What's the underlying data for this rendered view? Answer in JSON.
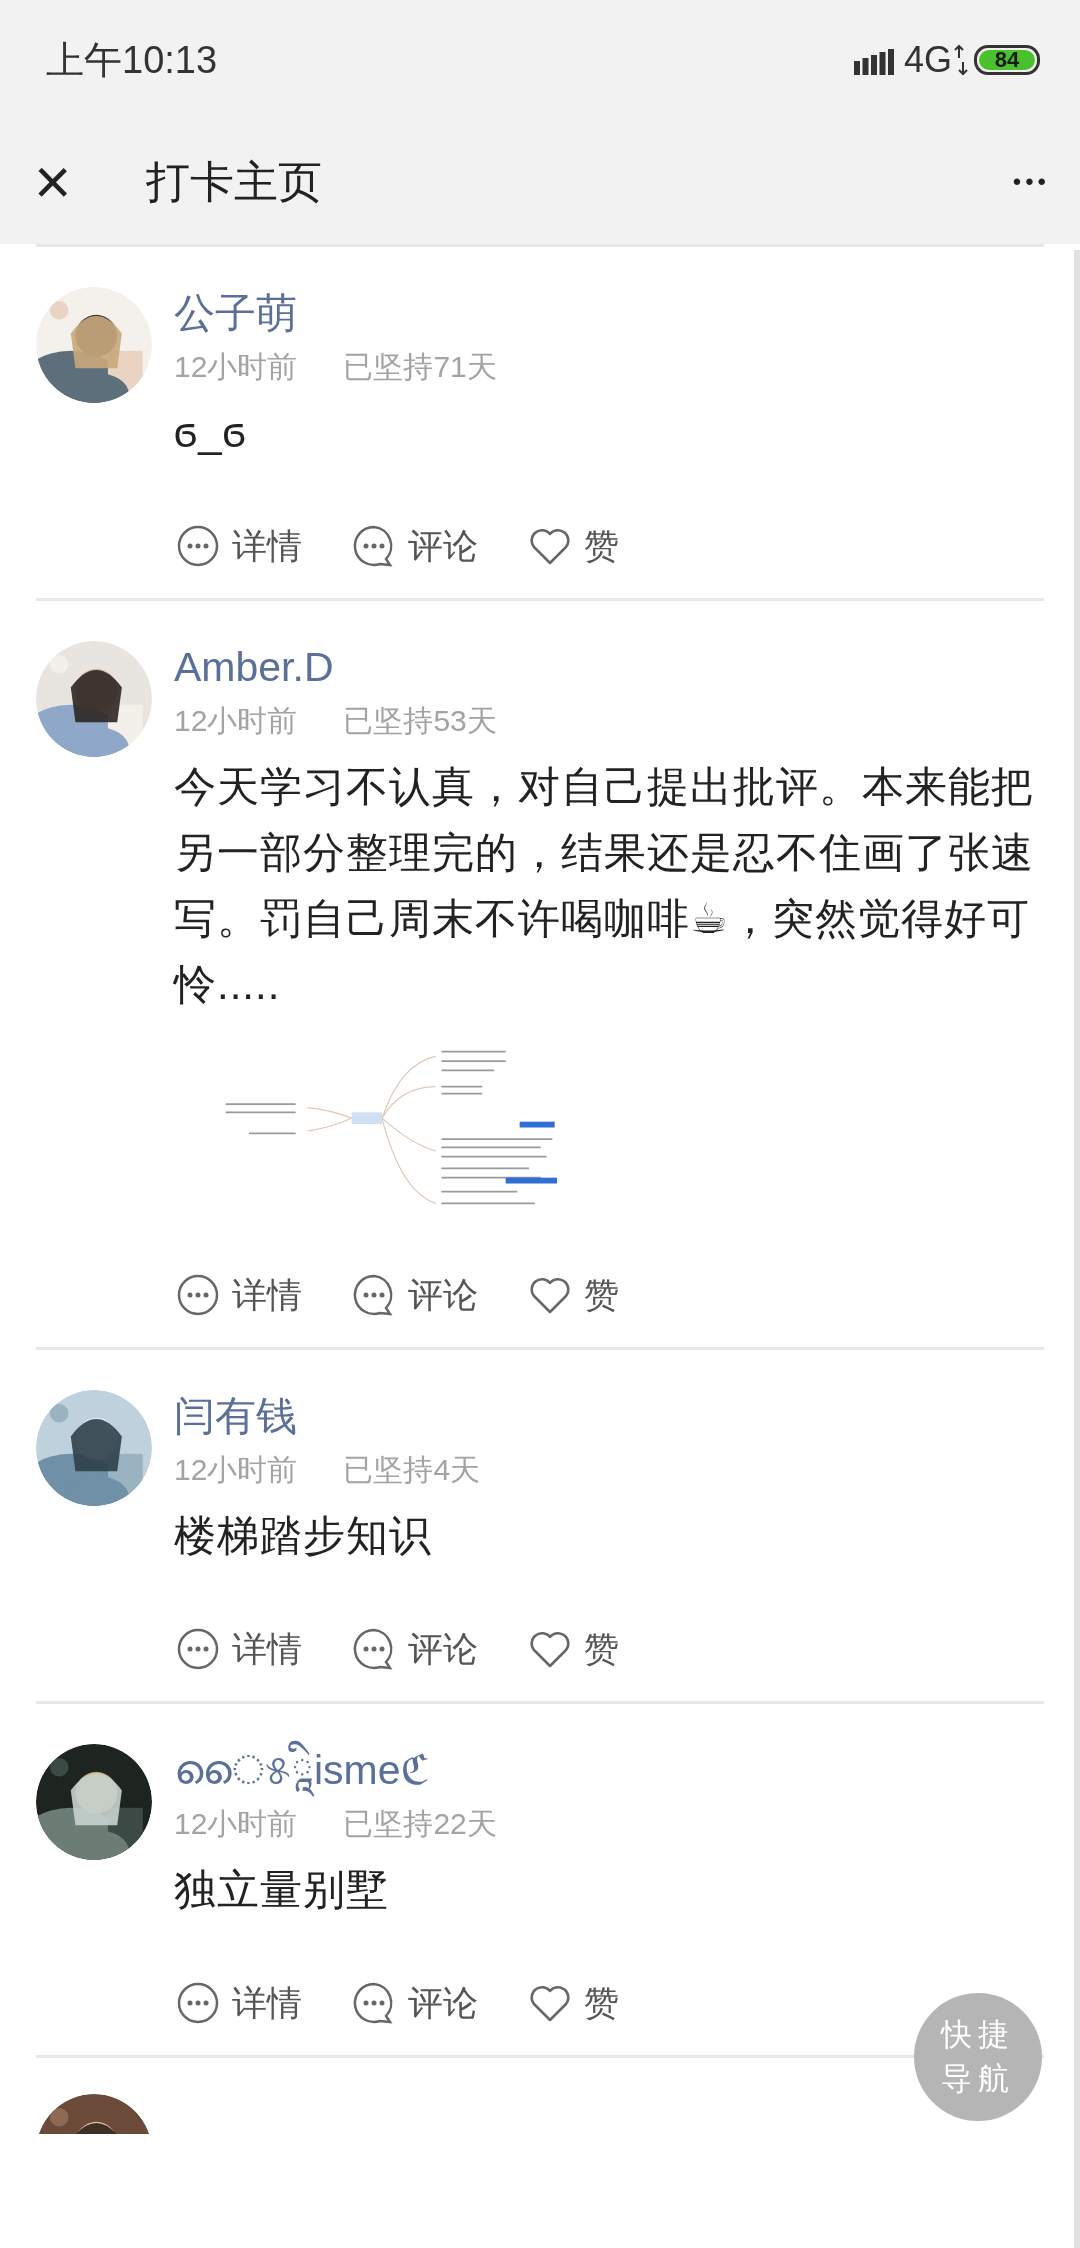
{
  "status_bar": {
    "time": "上午10:13",
    "network": "4G",
    "battery": "84"
  },
  "header": {
    "close": "×",
    "title": "打卡主页",
    "more": "•••"
  },
  "posts": [
    {
      "avatar": {
        "kind": "picture"
      },
      "name": "公子萌",
      "time": "12小时前",
      "streak": "已坚持71天",
      "content": "ϭ_ϭ",
      "actions": [
        {
          "kind": "detail",
          "label": "详情"
        },
        {
          "kind": "comment",
          "label": "评论"
        },
        {
          "kind": "like",
          "label": "赞"
        }
      ]
    },
    {
      "avatar": {
        "kind": "picture"
      },
      "name": "Amber.D",
      "time": "12小时前",
      "streak": "已坚持53天",
      "content": "今天学习不认真，对自己提出批评。本来能把另一部分整理完的，结果还是忍不住画了张速写。罚自己周末不许喝咖啡☕，突然觉得好可怜.....",
      "image": {
        "kind": "picture"
      },
      "actions": [
        {
          "kind": "detail",
          "label": "详情"
        },
        {
          "kind": "comment",
          "label": "评论"
        },
        {
          "kind": "like",
          "label": "赞"
        }
      ]
    },
    {
      "avatar": {
        "kind": "picture"
      },
      "name": "闫有钱",
      "time": "12小时前",
      "streak": "已坚持4天",
      "content": "楼梯踏步知识",
      "actions": [
        {
          "kind": "detail",
          "label": "详情"
        },
        {
          "kind": "comment",
          "label": "评论"
        },
        {
          "kind": "like",
          "label": "赞"
        }
      ]
    },
    {
      "avatar": {
        "kind": "picture"
      },
      "name": "ൈ୫ཱིismeℭ",
      "time": "12小时前",
      "streak": "已坚持22天",
      "content": "独立量别墅",
      "actions": [
        {
          "kind": "detail",
          "label": "详情"
        },
        {
          "kind": "comment",
          "label": "评论"
        },
        {
          "kind": "like",
          "label": "赞"
        }
      ]
    }
  ],
  "next_post": {
    "avatar": {
      "kind": "picture"
    }
  },
  "quick_nav": {
    "label": "快捷导航"
  }
}
